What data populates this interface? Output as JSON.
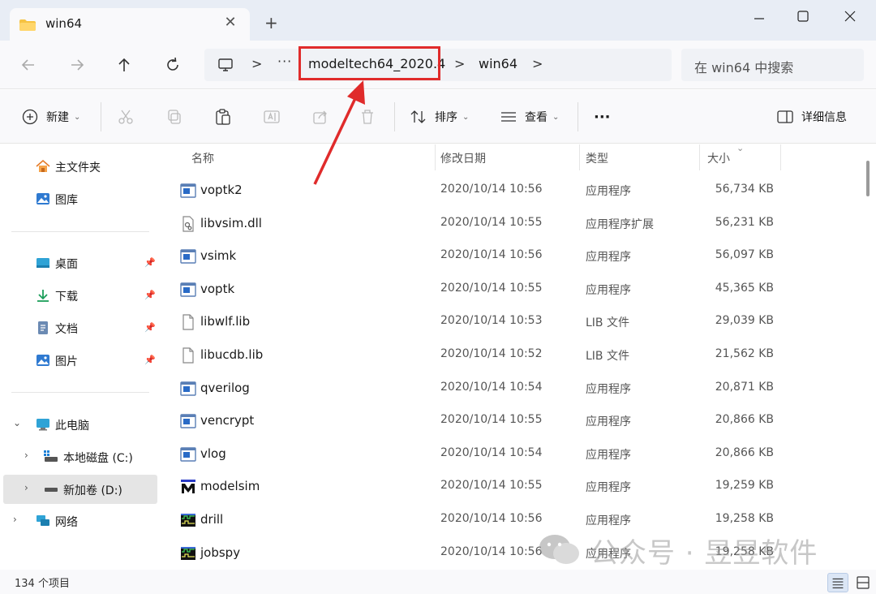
{
  "window": {
    "tab_title": "win64",
    "new_tab_label": "+"
  },
  "address": {
    "overflow_label": "···",
    "crumbs": [
      "modeltech64_2020.4",
      "win64"
    ],
    "separator": ">",
    "search_placeholder": "在 win64 中搜索"
  },
  "toolbar": {
    "new_label": "新建",
    "sort_label": "排序",
    "view_label": "查看",
    "more_label": "···",
    "details_label": "详细信息"
  },
  "sidebar": {
    "quick": [
      {
        "label": "主文件夹",
        "icon": "home-icon"
      },
      {
        "label": "图库",
        "icon": "gallery-icon"
      }
    ],
    "pinned": [
      {
        "label": "桌面",
        "icon": "desktop-icon"
      },
      {
        "label": "下载",
        "icon": "download-icon"
      },
      {
        "label": "文档",
        "icon": "documents-icon"
      },
      {
        "label": "图片",
        "icon": "pictures-icon"
      }
    ],
    "pc_label": "此电脑",
    "drives": [
      {
        "label": "本地磁盘 (C:)"
      },
      {
        "label": "新加卷 (D:)"
      }
    ],
    "network_label": "网络"
  },
  "columns": {
    "name": "名称",
    "modified": "修改日期",
    "type": "类型",
    "size": "大小"
  },
  "files": [
    {
      "name": "voptk2",
      "modified": "2020/10/14 10:56",
      "type": "应用程序",
      "size": "56,734 KB",
      "icon": "exe-icon"
    },
    {
      "name": "libvsim.dll",
      "modified": "2020/10/14 10:55",
      "type": "应用程序扩展",
      "size": "56,231 KB",
      "icon": "dll-icon"
    },
    {
      "name": "vsimk",
      "modified": "2020/10/14 10:56",
      "type": "应用程序",
      "size": "56,097 KB",
      "icon": "exe-icon"
    },
    {
      "name": "voptk",
      "modified": "2020/10/14 10:55",
      "type": "应用程序",
      "size": "45,365 KB",
      "icon": "exe-icon"
    },
    {
      "name": "libwlf.lib",
      "modified": "2020/10/14 10:53",
      "type": "LIB 文件",
      "size": "29,039 KB",
      "icon": "file-icon"
    },
    {
      "name": "libucdb.lib",
      "modified": "2020/10/14 10:52",
      "type": "LIB 文件",
      "size": "21,562 KB",
      "icon": "file-icon"
    },
    {
      "name": "qverilog",
      "modified": "2020/10/14 10:54",
      "type": "应用程序",
      "size": "20,871 KB",
      "icon": "exe-icon"
    },
    {
      "name": "vencrypt",
      "modified": "2020/10/14 10:55",
      "type": "应用程序",
      "size": "20,866 KB",
      "icon": "exe-icon"
    },
    {
      "name": "vlog",
      "modified": "2020/10/14 10:54",
      "type": "应用程序",
      "size": "20,866 KB",
      "icon": "exe-icon"
    },
    {
      "name": "modelsim",
      "modified": "2020/10/14 10:55",
      "type": "应用程序",
      "size": "19,259 KB",
      "icon": "modelsim-icon"
    },
    {
      "name": "drill",
      "modified": "2020/10/14 10:56",
      "type": "应用程序",
      "size": "19,258 KB",
      "icon": "waveform-icon"
    },
    {
      "name": "jobspy",
      "modified": "2020/10/14 10:56",
      "type": "应用程序",
      "size": "19,258 KB",
      "icon": "waveform-icon"
    }
  ],
  "status": {
    "item_count": "134 个项目"
  },
  "watermark": {
    "text": "公众号 · 昱昱软件"
  },
  "colors": {
    "highlight": "#e02b2b",
    "selected": "#e5e5e5",
    "titlebar": "#e8edf5"
  }
}
